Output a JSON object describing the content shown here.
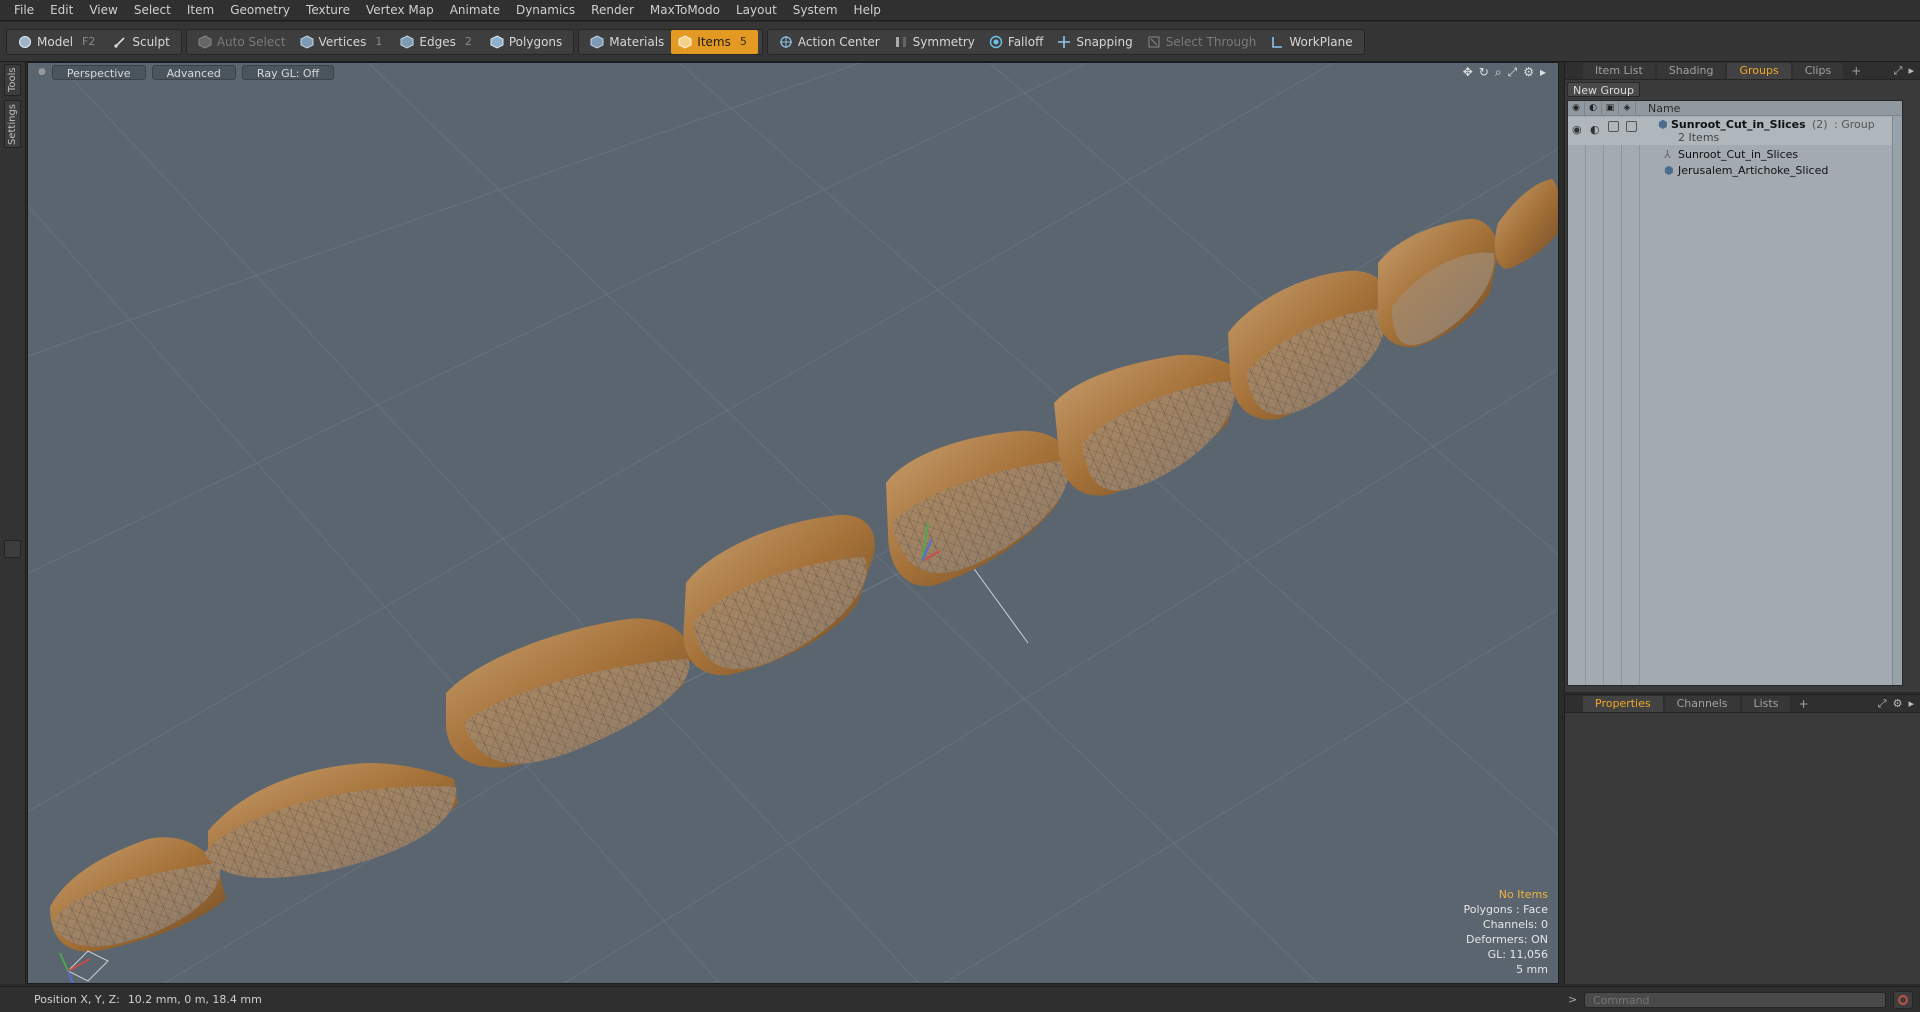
{
  "menu": [
    "File",
    "Edit",
    "View",
    "Select",
    "Item",
    "Geometry",
    "Texture",
    "Vertex Map",
    "Animate",
    "Dynamics",
    "Render",
    "MaxToModo",
    "Layout",
    "System",
    "Help"
  ],
  "toolbar": {
    "model": "Model",
    "model_key": "F2",
    "sculpt": "Sculpt",
    "auto_select": "Auto Select",
    "vertices": "Vertices",
    "vertices_key": "1",
    "edges": "Edges",
    "edges_key": "2",
    "polygons": "Polygons",
    "materials": "Materials",
    "items": "Items",
    "items_key": "5",
    "action_center": "Action Center",
    "symmetry": "Symmetry",
    "falloff": "Falloff",
    "snapping": "Snapping",
    "select_through": "Select Through",
    "workplane": "WorkPlane"
  },
  "left_strip": {
    "tools": "Tools",
    "settings": "Settings"
  },
  "viewport": {
    "view_mode": "Perspective",
    "shading": "Advanced",
    "raygl": "Ray GL: Off",
    "info": {
      "selection": "No Items",
      "polygons": "Polygons : Face",
      "channels": "Channels: 0",
      "deformers": "Deformers: ON",
      "gl": "GL: 11,056",
      "grid": "5 mm"
    }
  },
  "top_panel": {
    "tabs": [
      "Item List",
      "Shading",
      "Groups",
      "Clips"
    ],
    "active_tab": "Groups",
    "new_group": "New Group",
    "name_header": "Name",
    "group": {
      "name": "Sunroot_Cut_in_Slices",
      "count": "(2)",
      "type": ": Group",
      "items": "2 Items"
    },
    "children": [
      "Sunroot_Cut_in_Slices",
      "Jerusalem_Artichoke_Sliced"
    ]
  },
  "bottom_panel": {
    "tabs": [
      "Properties",
      "Channels",
      "Lists"
    ],
    "active_tab": "Properties"
  },
  "status": {
    "position_label": "Position X, Y, Z:",
    "position_value": "10.2 mm, 0 m, 18.4 mm",
    "command_placeholder": "Command"
  },
  "colors": {
    "accent": "#e49a22",
    "viewport_bg": "#5a656f",
    "slice_skin": "#a6743a",
    "slice_flesh": "#9a826a"
  }
}
